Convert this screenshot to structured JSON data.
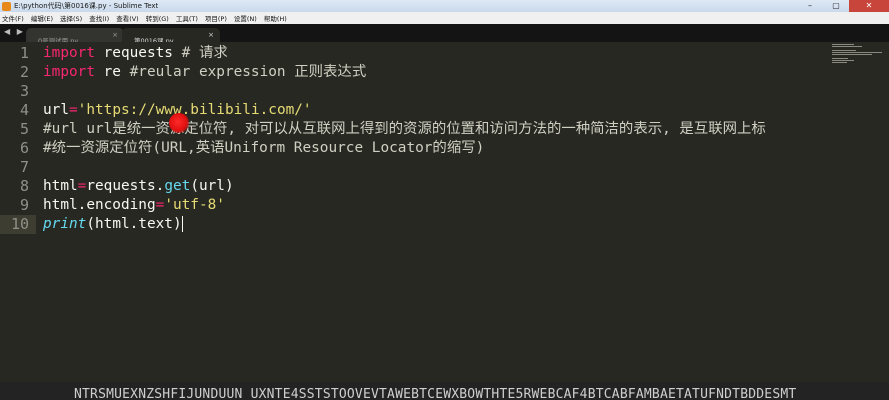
{
  "window": {
    "title": "E:\\python代码\\第0016课.py - Sublime Text",
    "minimize": "–",
    "maximize": "▢",
    "close": "✕"
  },
  "menu": [
    "文件(F)",
    "编辑(E)",
    "选择(S)",
    "查找(I)",
    "查看(V)",
    "转到(G)",
    "工具(T)",
    "项目(P)",
    "设置(N)",
    "帮助(H)"
  ],
  "tabbar": {
    "nav": "◀ ▶",
    "tabs": [
      {
        "label": "0号测试用.py",
        "close": "×",
        "active": false
      },
      {
        "label": "第0016课.py",
        "close": "×",
        "active": true
      }
    ]
  },
  "editor": {
    "current_line": 10,
    "line_numbers": [
      "1",
      "2",
      "3",
      "4",
      "5",
      "6",
      "7",
      "8",
      "9",
      "10"
    ],
    "lines": {
      "l1": {
        "kw": "import",
        "mod": " requests ",
        "comment": "# 请求"
      },
      "l2": {
        "kw": "import",
        "mod": " re ",
        "comment": "#reular expression 正则表达式"
      },
      "l4": {
        "var": "url",
        "op": "=",
        "str": "'https://www.bilibili.com/'"
      },
      "l5": {
        "comment": "#url url是统一资源定位符, 对可以从互联网上得到的资源的位置和访问方法的一种简洁的表示, 是互联网上标"
      },
      "l6": {
        "comment": "#统一资源定位符(URL,英语Uniform Resource Locator的缩写)"
      },
      "l8": {
        "var": "html",
        "op": "=",
        "obj": "requests.",
        "fn": "get",
        "args": "(url)"
      },
      "l9": {
        "obj": "html.encoding",
        "op": "=",
        "str": "'utf-8'"
      },
      "l10": {
        "fn": "print",
        "args": "(html.text)"
      }
    }
  },
  "bottom_fragment": "NTRSMUEXNZSHFIJUNDUUN UXNTE4SSTSTOOVEVTAWEBTCEWXBOWTHTE5RWEBCAF4BTCABFAMBAETATUFNDTBDDESMT",
  "colors": {
    "background": "#272822",
    "keyword": "#f92672",
    "string": "#e6db74",
    "function": "#66d9ef",
    "text": "#f8f8f2",
    "gutter": "#8f908a"
  }
}
